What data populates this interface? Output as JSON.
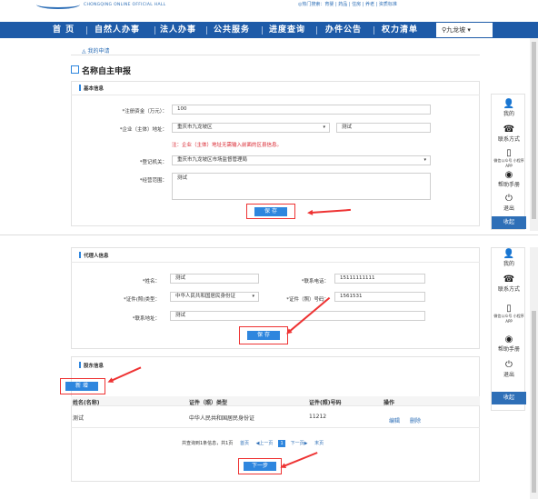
{
  "header": {
    "site_en": "CHONGQING ONLINE OFFICIAL HALL",
    "top_links": "◎热门搜索：育婴 | 药品 | 住房 | 养老 | 资质标准",
    "nav": [
      "首  页",
      "自然人办事",
      "法人办事",
      "公共服务",
      "进度查询",
      "办件公告",
      "权力清单"
    ],
    "region": "⚲九龙坡 ▾"
  },
  "breadcrumb": "◬ 我的申请",
  "page_title": "名称自主申报",
  "basic_info": {
    "section": "基本信息",
    "capital_label": "*注册资金（万元）：",
    "capital_value": "100",
    "address_label": "*企业（主体）地址：",
    "address_district": "重庆市九龙坡区",
    "address_detail": "测试",
    "address_note": "注：企业（主体）地址无需输入前面的区县信息。",
    "authority_label": "*登记机关：",
    "authority_value": "重庆市九龙坡区市场监督管理局",
    "scope_label": "*经营范围：",
    "scope_value": "测试",
    "save": "保 存"
  },
  "agent_info": {
    "section": "代理人信息",
    "name_label": "*姓名：",
    "name_value": "测试",
    "phone_label": "*联系电话：",
    "phone_value": "15111111111",
    "idtype_label": "*证件(照)类型：",
    "idtype_value": "中华人民共和国居民身份证",
    "idno_label": "*证件（照）号码：",
    "idno_value": "1561531",
    "addr_label": "*联系地址：",
    "addr_value": "测试",
    "save": "保 存"
  },
  "shareholder": {
    "section": "股东信息",
    "add": "新 增",
    "columns": [
      "姓名(名称)",
      "证件（照）类型",
      "证件(照)号码",
      "操作"
    ],
    "rows": [
      {
        "name": "测试",
        "type": "中华人民共和国居民身份证",
        "number": "11212",
        "edit": "编辑",
        "delete": "删除"
      }
    ],
    "pager_text": "共查询到1条信息，共1页",
    "pager_first": "首页",
    "pager_prev": "◀上一页",
    "pager_current": "1",
    "pager_next": "下一页▶",
    "pager_last": "末页",
    "next_step": "下一步"
  },
  "sidebar": {
    "items": [
      {
        "icon": "user-icon",
        "label": "我的"
      },
      {
        "icon": "phone-icon",
        "label": "联系方式"
      },
      {
        "icon": "mobile-icon",
        "label": "微信公众号\n小程序APP"
      },
      {
        "icon": "help-icon",
        "label": "帮助手册"
      },
      {
        "icon": "power-icon",
        "label": "退出"
      }
    ],
    "bottom": "收起"
  },
  "colors": {
    "nav": "#1e5ba8",
    "accent": "#2e86de",
    "alert": "#e33333"
  }
}
